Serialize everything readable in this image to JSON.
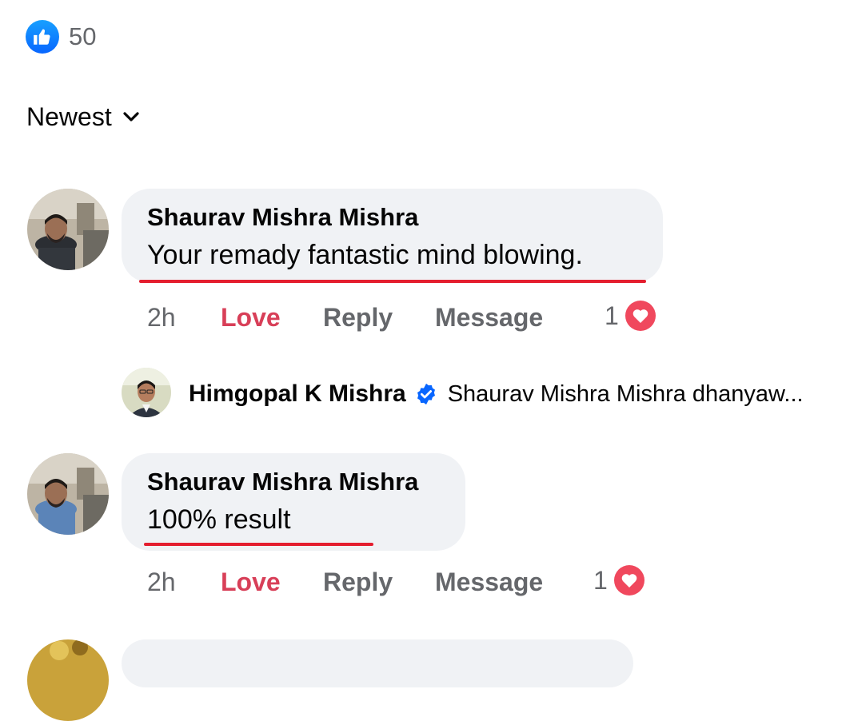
{
  "reactions": {
    "like_icon": "thumbs-up-icon",
    "count": "50"
  },
  "sort": {
    "label": "Newest",
    "icon": "chevron-down-icon"
  },
  "comments": [
    {
      "author": "Shaurav Mishra Mishra",
      "text": "Your remady fantastic mind blowing.",
      "time": "2h",
      "love_label": "Love",
      "reply_label": "Reply",
      "message_label": "Message",
      "reaction_count": "1",
      "reaction_icon": "heart-icon"
    },
    {
      "author": "Shaurav Mishra Mishra",
      "text": "100% result",
      "time": "2h",
      "love_label": "Love",
      "reply_label": "Reply",
      "message_label": "Message",
      "reaction_count": "1",
      "reaction_icon": "heart-icon"
    }
  ],
  "reply_preview": {
    "author": "Himgopal K Mishra",
    "verified_icon": "verified-badge-icon",
    "text": "Shaurav Mishra Mishra dhanyaw..."
  },
  "colors": {
    "accent_blue": "#0866ff",
    "love_red": "#d83f58",
    "bubble_bg": "#f0f2f5",
    "underline_red": "#e41e2f",
    "muted_text": "#65676b"
  }
}
